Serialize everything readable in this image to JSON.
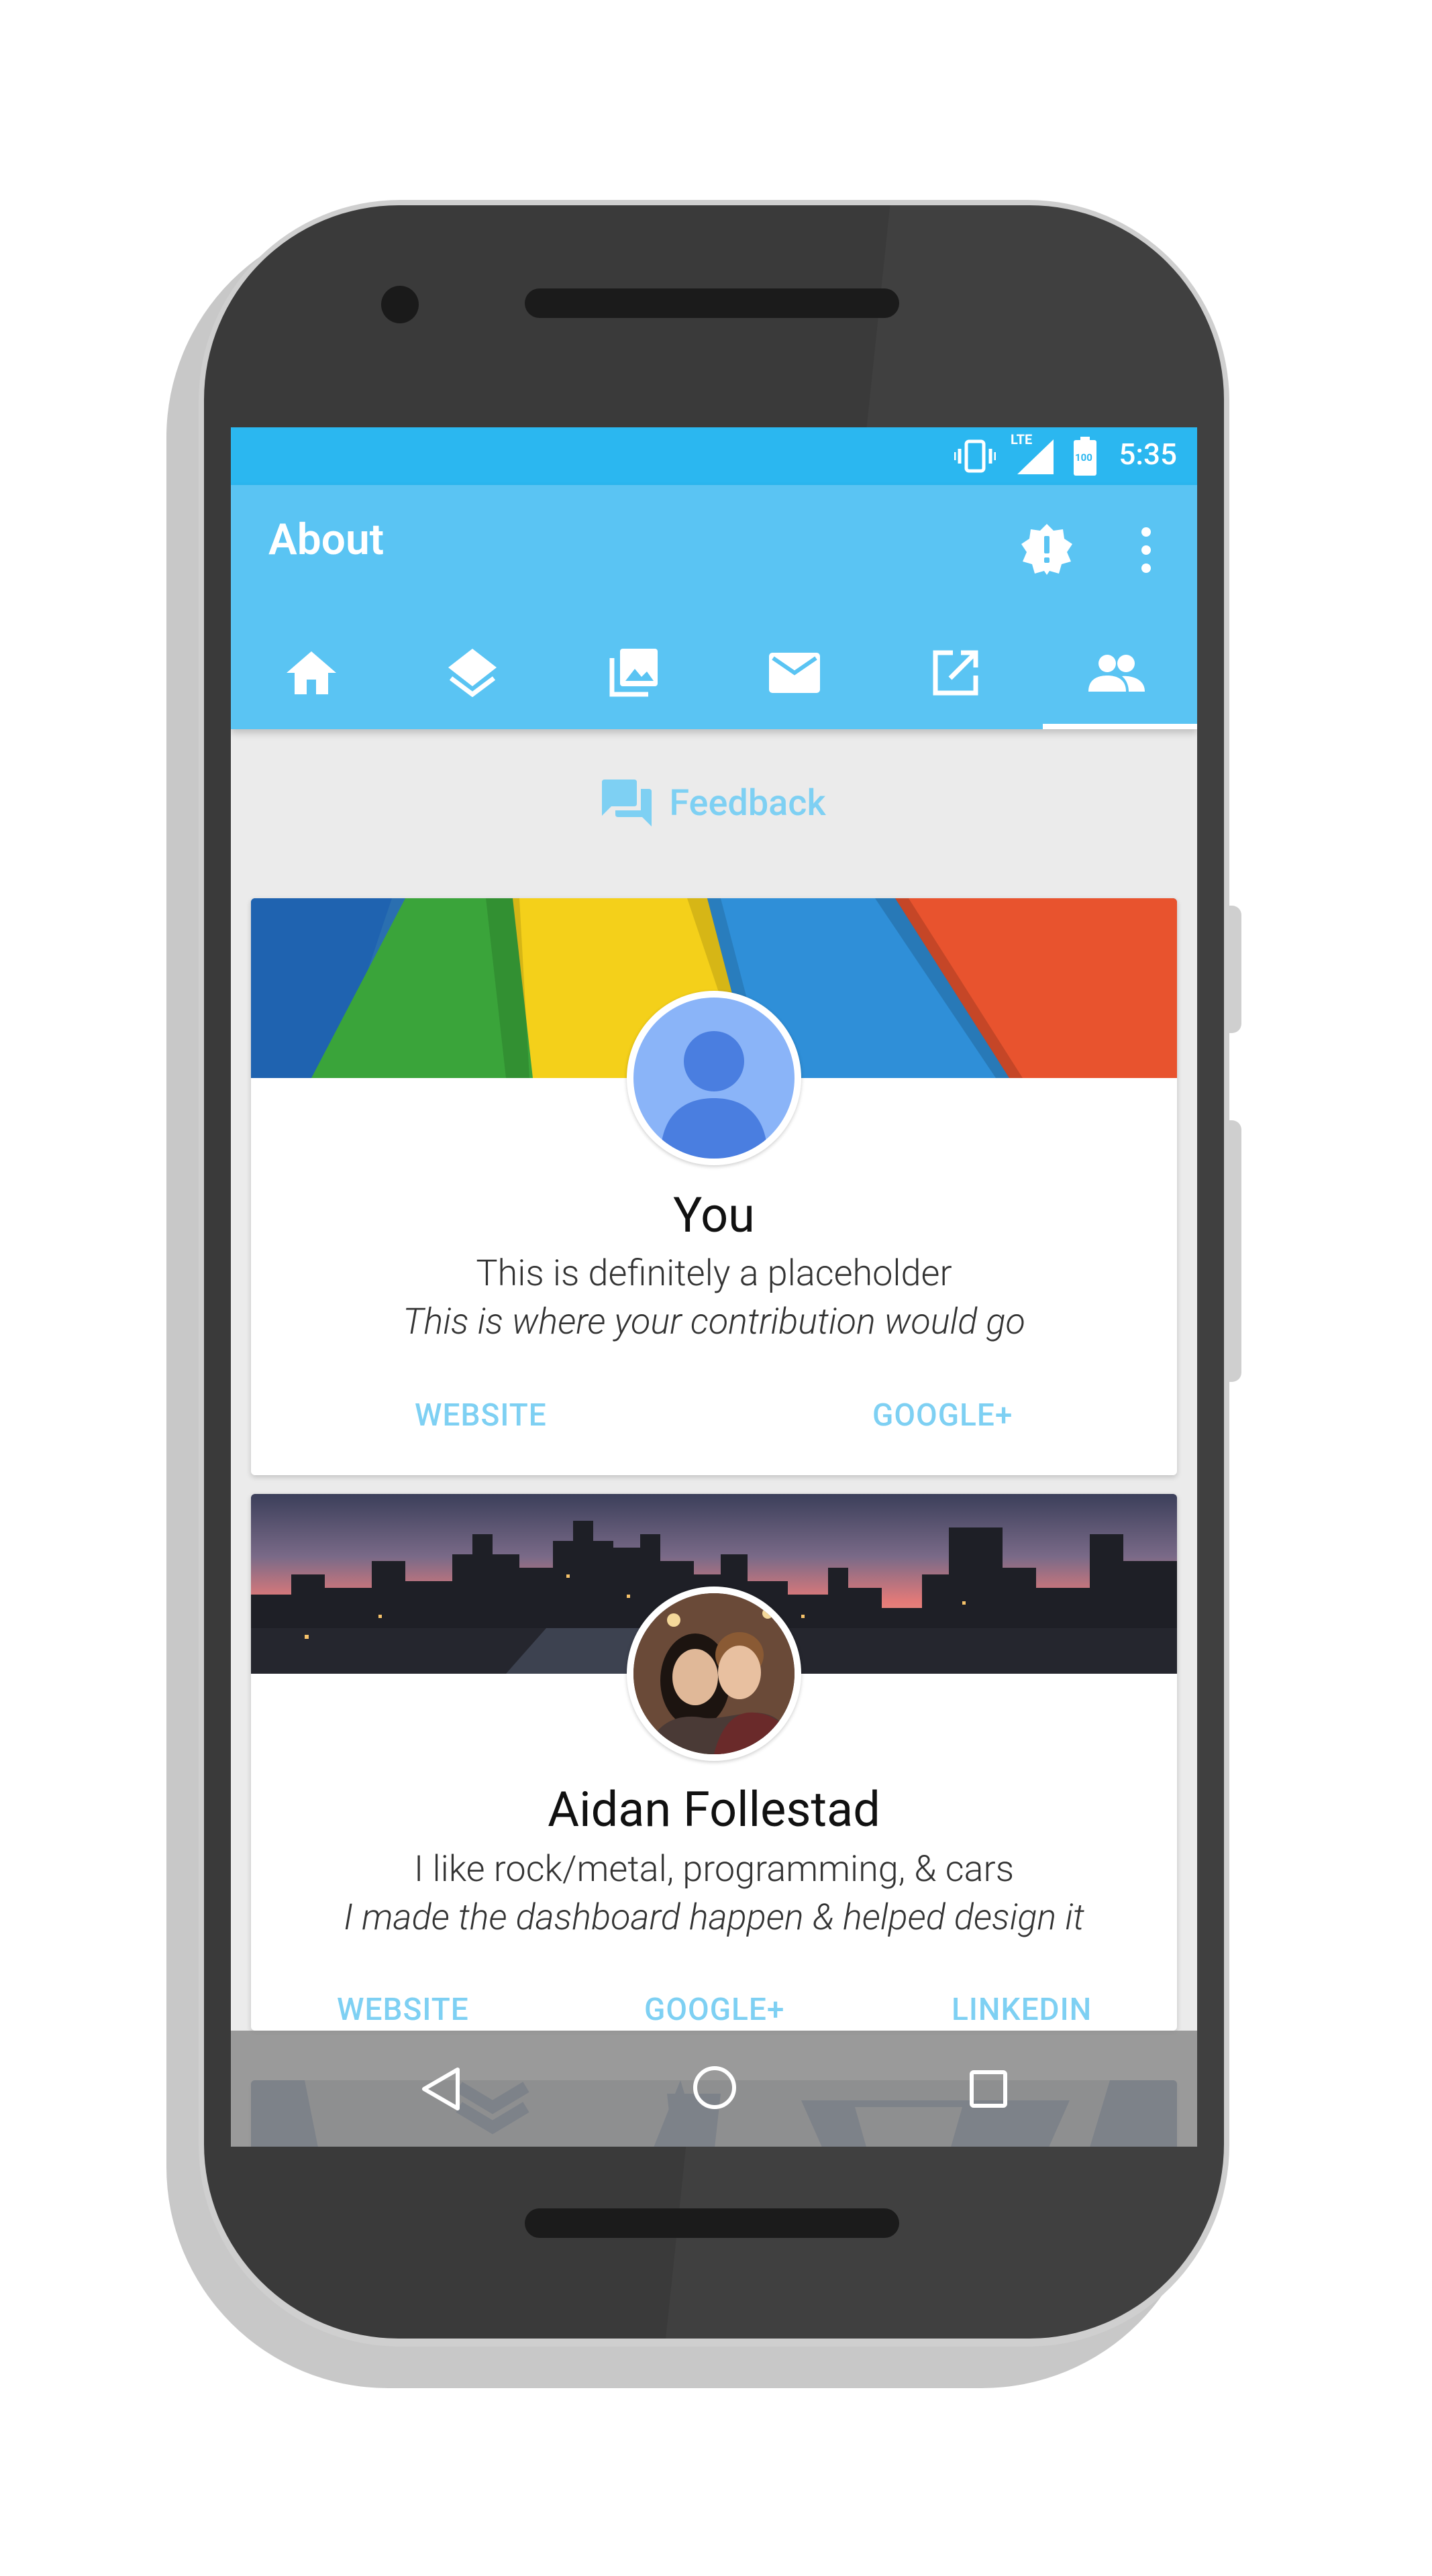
{
  "status_bar": {
    "network_label": "LTE",
    "battery_label": "100",
    "time": "5:35"
  },
  "app_bar": {
    "title": "About",
    "actions": [
      "badge-alert-icon",
      "more-vert-icon"
    ]
  },
  "tabs": [
    {
      "icon": "home-icon",
      "selected": false
    },
    {
      "icon": "layers-icon",
      "selected": false
    },
    {
      "icon": "photo-library-icon",
      "selected": false
    },
    {
      "icon": "email-icon",
      "selected": false
    },
    {
      "icon": "open-in-new-icon",
      "selected": false
    },
    {
      "icon": "people-icon",
      "selected": true
    }
  ],
  "feedback": {
    "icon": "forum-icon",
    "label": "Feedback"
  },
  "cards": [
    {
      "name": "You",
      "line1": "This is definitely a placeholder",
      "line2": "This is where your contribution would go",
      "buttons": [
        "WEBSITE",
        "GOOGLE+"
      ]
    },
    {
      "name": "Aidan Follestad",
      "line1": "I like rock/metal, programming, & cars",
      "line2": "I made the dashboard happen & helped design it",
      "buttons": [
        "WEBSITE",
        "GOOGLE+",
        "LINKEDIN"
      ]
    }
  ],
  "nav_bar": {
    "buttons": [
      "back-icon",
      "home-circle-icon",
      "recents-icon"
    ]
  },
  "colors": {
    "status_bar": "#2bb7f0",
    "app_bar": "#5ac4f3",
    "accent": "#7ed0f3",
    "phone_body": "#3a3a3a"
  }
}
